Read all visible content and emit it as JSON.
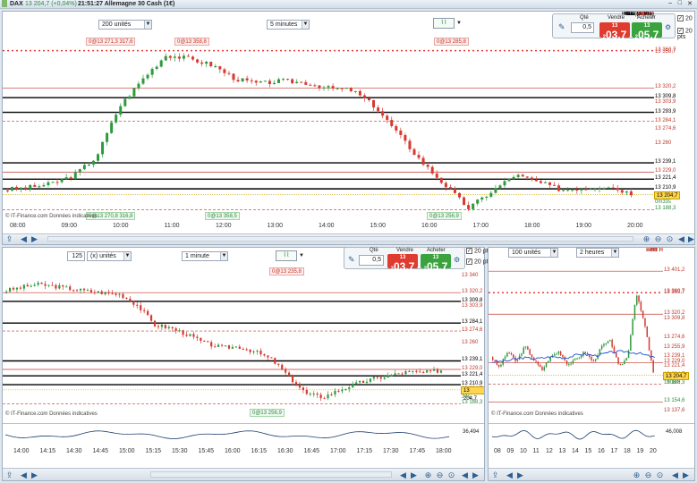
{
  "title_bar": {
    "symbol": "DAX",
    "quote": "13 204,7 (+0,04%)",
    "time_market": "21:51:27 Allemagne 30 Cash (1€)"
  },
  "window_buttons": {
    "minimize": "–",
    "maximize": "□",
    "close": "✕"
  },
  "order_panel": {
    "qty_label": "Qté",
    "qty_value": "0,5",
    "sell_label": "Vendre",
    "buy_label": "Acheter",
    "sell_small": "13 2",
    "sell_big": "03,7",
    "buy_small": "13 2",
    "buy_big": "05,7",
    "pts1": "20",
    "pts2": "20",
    "pts_label": "pts"
  },
  "top_chart": {
    "units_select": "200 unités",
    "interval_select": "5 minutes",
    "signals_top": [
      "0@13 271,3  317,6",
      "0@13 358,8",
      "0@13 285,8"
    ],
    "signals_bottom": [
      "0@13 270,8  316,8",
      "0@13 358,5",
      "0@13 256,9"
    ],
    "watermark": "© IT-Finance.com  Données indicatives",
    "price_labels": [
      {
        "text": "mPR H",
        "value": "13 360,7"
      },
      {
        "text": "",
        "value": "13 358,7"
      },
      {
        "text": "R1 H",
        "value": "13 320,2"
      },
      {
        "text": "Haut (Hebdo)",
        "value": "13 309,8"
      },
      {
        "text": "",
        "value": "13 303,9"
      },
      {
        "text": "Haut (J. Bre)",
        "value": "13 293,9"
      },
      {
        "text": "mR1 H",
        "value": "13 284,1"
      },
      {
        "text": "",
        "value": "13 274,6"
      },
      {
        "text": "",
        "value": "13 260"
      },
      {
        "text": "Clôt (J. Bre)",
        "value": "13 239,1"
      },
      {
        "text": "Piv H",
        "value": "13 229,0"
      },
      {
        "text": "Ouv (J. Bre)",
        "value": "13 221,4"
      },
      {
        "text": "Clo (J. Bre)",
        "value": "13 210,9"
      },
      {
        "text": "mS1 H",
        "value": "13 188,3"
      }
    ],
    "current_price": "13 204,7",
    "countdown": "0m33s",
    "x_labels": [
      "08:00",
      "09:00",
      "10:00",
      "11:00",
      "12:00",
      "13:00",
      "14:00",
      "15:00",
      "16:00",
      "17:00",
      "18:00",
      "19:00",
      "20:00"
    ]
  },
  "bottom_left_chart": {
    "units_value": "125",
    "units_select": "(x) unités",
    "interval_select": "1 minute",
    "signal_top": "0@13 235,8",
    "signal_bottom": "0@13 256,9",
    "watermark": "© IT-Finance.com  Données indicatives",
    "price_labels": [
      {
        "text": "",
        "value": "13 340"
      },
      {
        "text": "R1 H",
        "value": "13 320,2"
      },
      {
        "text": "Haut (Hebdo)",
        "value": "13 309,8"
      },
      {
        "text": "",
        "value": "13 303,9"
      },
      {
        "text": "Haut (J. Bre)",
        "value": "13 284,1"
      },
      {
        "text": "mR1 H",
        "value": "13 274,6"
      },
      {
        "text": "",
        "value": "13 260"
      },
      {
        "text": "Clôt (J. Bre)",
        "value": "13 239,1"
      },
      {
        "text": "Piv H",
        "value": "13 229,0"
      },
      {
        "text": "Ouv (J. Bre)",
        "value": "13 221,4"
      },
      {
        "text": "Clo (J. Bre)",
        "value": "13 210,9"
      },
      {
        "text": "",
        "value": "13 204,7"
      },
      {
        "text": "mS1 H",
        "value": "13 188,3"
      }
    ],
    "countdown": "34s",
    "indicator_value": "36,494",
    "x_labels": [
      "14:00",
      "14:15",
      "14:30",
      "14:45",
      "15:00",
      "15:15",
      "15:30",
      "15:45",
      "16:00",
      "16:15",
      "16:30",
      "16:45",
      "17:00",
      "17:15",
      "17:30",
      "17:45",
      "18:00"
    ]
  },
  "bottom_mid_order": {
    "qty_label": "Qté",
    "qty_value": "0,5",
    "sell_label": "Vendre",
    "buy_label": "Acheter",
    "sell_small": "13 2",
    "sell_big": "03,7",
    "buy_small": "13 2",
    "buy_big": "05,7",
    "pts1": "20",
    "pts2": "20",
    "pts_label": "pts"
  },
  "bottom_right_chart": {
    "units_select": "100 unités",
    "interval_select": "2 heures",
    "watermark": "© IT-Finance.com  Données indicatives",
    "price_labels": [
      {
        "text": "R2 H",
        "value": "13 401,2"
      },
      {
        "text": "mPR H",
        "value": "13 360,7"
      },
      {
        "text": "",
        "value": "13 359,7"
      },
      {
        "text": "R1 H",
        "value": "13 320,2"
      },
      {
        "text": "",
        "value": "13 309,8"
      },
      {
        "text": "",
        "value": "13 274,6"
      },
      {
        "text": "",
        "value": "13 255,9"
      },
      {
        "text": "",
        "value": "13 239,1"
      },
      {
        "text": "Piv H",
        "value": "13 229,0"
      },
      {
        "text": "",
        "value": "13 221,4"
      },
      {
        "text": "",
        "value": "13 204,7"
      },
      {
        "text": "mS1 H",
        "value": "13 188,3"
      },
      {
        "text": "S1 H",
        "value": "13 154,6"
      },
      {
        "text": "",
        "value": "13 137,6"
      }
    ],
    "countdown": "1h08m",
    "indicator_value": "46,008",
    "x_labels": [
      "08",
      "09",
      "10",
      "11",
      "12",
      "13",
      "14",
      "15",
      "16",
      "17",
      "18",
      "19",
      "20"
    ]
  },
  "toolbar_icons": [
    "share-icon",
    "arrow-left-icon",
    "arrow-right-icon",
    "zoom-in-icon",
    "zoom-out-icon",
    "zoom-fit-icon"
  ]
}
